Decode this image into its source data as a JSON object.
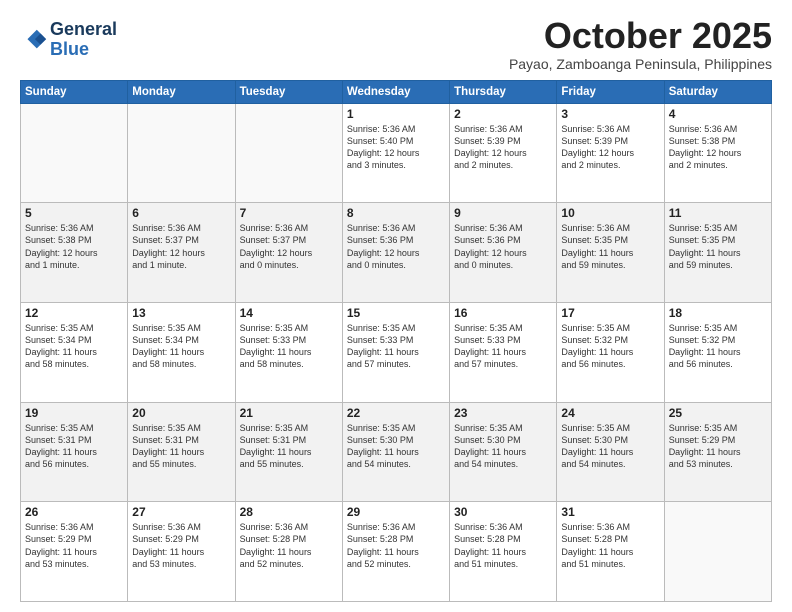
{
  "logo": {
    "line1": "General",
    "line2": "Blue"
  },
  "title": "October 2025",
  "subtitle": "Payao, Zamboanga Peninsula, Philippines",
  "weekdays": [
    "Sunday",
    "Monday",
    "Tuesday",
    "Wednesday",
    "Thursday",
    "Friday",
    "Saturday"
  ],
  "weeks": [
    [
      {
        "day": "",
        "text": ""
      },
      {
        "day": "",
        "text": ""
      },
      {
        "day": "",
        "text": ""
      },
      {
        "day": "1",
        "text": "Sunrise: 5:36 AM\nSunset: 5:40 PM\nDaylight: 12 hours\nand 3 minutes."
      },
      {
        "day": "2",
        "text": "Sunrise: 5:36 AM\nSunset: 5:39 PM\nDaylight: 12 hours\nand 2 minutes."
      },
      {
        "day": "3",
        "text": "Sunrise: 5:36 AM\nSunset: 5:39 PM\nDaylight: 12 hours\nand 2 minutes."
      },
      {
        "day": "4",
        "text": "Sunrise: 5:36 AM\nSunset: 5:38 PM\nDaylight: 12 hours\nand 2 minutes."
      }
    ],
    [
      {
        "day": "5",
        "text": "Sunrise: 5:36 AM\nSunset: 5:38 PM\nDaylight: 12 hours\nand 1 minute."
      },
      {
        "day": "6",
        "text": "Sunrise: 5:36 AM\nSunset: 5:37 PM\nDaylight: 12 hours\nand 1 minute."
      },
      {
        "day": "7",
        "text": "Sunrise: 5:36 AM\nSunset: 5:37 PM\nDaylight: 12 hours\nand 0 minutes."
      },
      {
        "day": "8",
        "text": "Sunrise: 5:36 AM\nSunset: 5:36 PM\nDaylight: 12 hours\nand 0 minutes."
      },
      {
        "day": "9",
        "text": "Sunrise: 5:36 AM\nSunset: 5:36 PM\nDaylight: 12 hours\nand 0 minutes."
      },
      {
        "day": "10",
        "text": "Sunrise: 5:36 AM\nSunset: 5:35 PM\nDaylight: 11 hours\nand 59 minutes."
      },
      {
        "day": "11",
        "text": "Sunrise: 5:35 AM\nSunset: 5:35 PM\nDaylight: 11 hours\nand 59 minutes."
      }
    ],
    [
      {
        "day": "12",
        "text": "Sunrise: 5:35 AM\nSunset: 5:34 PM\nDaylight: 11 hours\nand 58 minutes."
      },
      {
        "day": "13",
        "text": "Sunrise: 5:35 AM\nSunset: 5:34 PM\nDaylight: 11 hours\nand 58 minutes."
      },
      {
        "day": "14",
        "text": "Sunrise: 5:35 AM\nSunset: 5:33 PM\nDaylight: 11 hours\nand 58 minutes."
      },
      {
        "day": "15",
        "text": "Sunrise: 5:35 AM\nSunset: 5:33 PM\nDaylight: 11 hours\nand 57 minutes."
      },
      {
        "day": "16",
        "text": "Sunrise: 5:35 AM\nSunset: 5:33 PM\nDaylight: 11 hours\nand 57 minutes."
      },
      {
        "day": "17",
        "text": "Sunrise: 5:35 AM\nSunset: 5:32 PM\nDaylight: 11 hours\nand 56 minutes."
      },
      {
        "day": "18",
        "text": "Sunrise: 5:35 AM\nSunset: 5:32 PM\nDaylight: 11 hours\nand 56 minutes."
      }
    ],
    [
      {
        "day": "19",
        "text": "Sunrise: 5:35 AM\nSunset: 5:31 PM\nDaylight: 11 hours\nand 56 minutes."
      },
      {
        "day": "20",
        "text": "Sunrise: 5:35 AM\nSunset: 5:31 PM\nDaylight: 11 hours\nand 55 minutes."
      },
      {
        "day": "21",
        "text": "Sunrise: 5:35 AM\nSunset: 5:31 PM\nDaylight: 11 hours\nand 55 minutes."
      },
      {
        "day": "22",
        "text": "Sunrise: 5:35 AM\nSunset: 5:30 PM\nDaylight: 11 hours\nand 54 minutes."
      },
      {
        "day": "23",
        "text": "Sunrise: 5:35 AM\nSunset: 5:30 PM\nDaylight: 11 hours\nand 54 minutes."
      },
      {
        "day": "24",
        "text": "Sunrise: 5:35 AM\nSunset: 5:30 PM\nDaylight: 11 hours\nand 54 minutes."
      },
      {
        "day": "25",
        "text": "Sunrise: 5:35 AM\nSunset: 5:29 PM\nDaylight: 11 hours\nand 53 minutes."
      }
    ],
    [
      {
        "day": "26",
        "text": "Sunrise: 5:36 AM\nSunset: 5:29 PM\nDaylight: 11 hours\nand 53 minutes."
      },
      {
        "day": "27",
        "text": "Sunrise: 5:36 AM\nSunset: 5:29 PM\nDaylight: 11 hours\nand 53 minutes."
      },
      {
        "day": "28",
        "text": "Sunrise: 5:36 AM\nSunset: 5:28 PM\nDaylight: 11 hours\nand 52 minutes."
      },
      {
        "day": "29",
        "text": "Sunrise: 5:36 AM\nSunset: 5:28 PM\nDaylight: 11 hours\nand 52 minutes."
      },
      {
        "day": "30",
        "text": "Sunrise: 5:36 AM\nSunset: 5:28 PM\nDaylight: 11 hours\nand 51 minutes."
      },
      {
        "day": "31",
        "text": "Sunrise: 5:36 AM\nSunset: 5:28 PM\nDaylight: 11 hours\nand 51 minutes."
      },
      {
        "day": "",
        "text": ""
      }
    ]
  ]
}
